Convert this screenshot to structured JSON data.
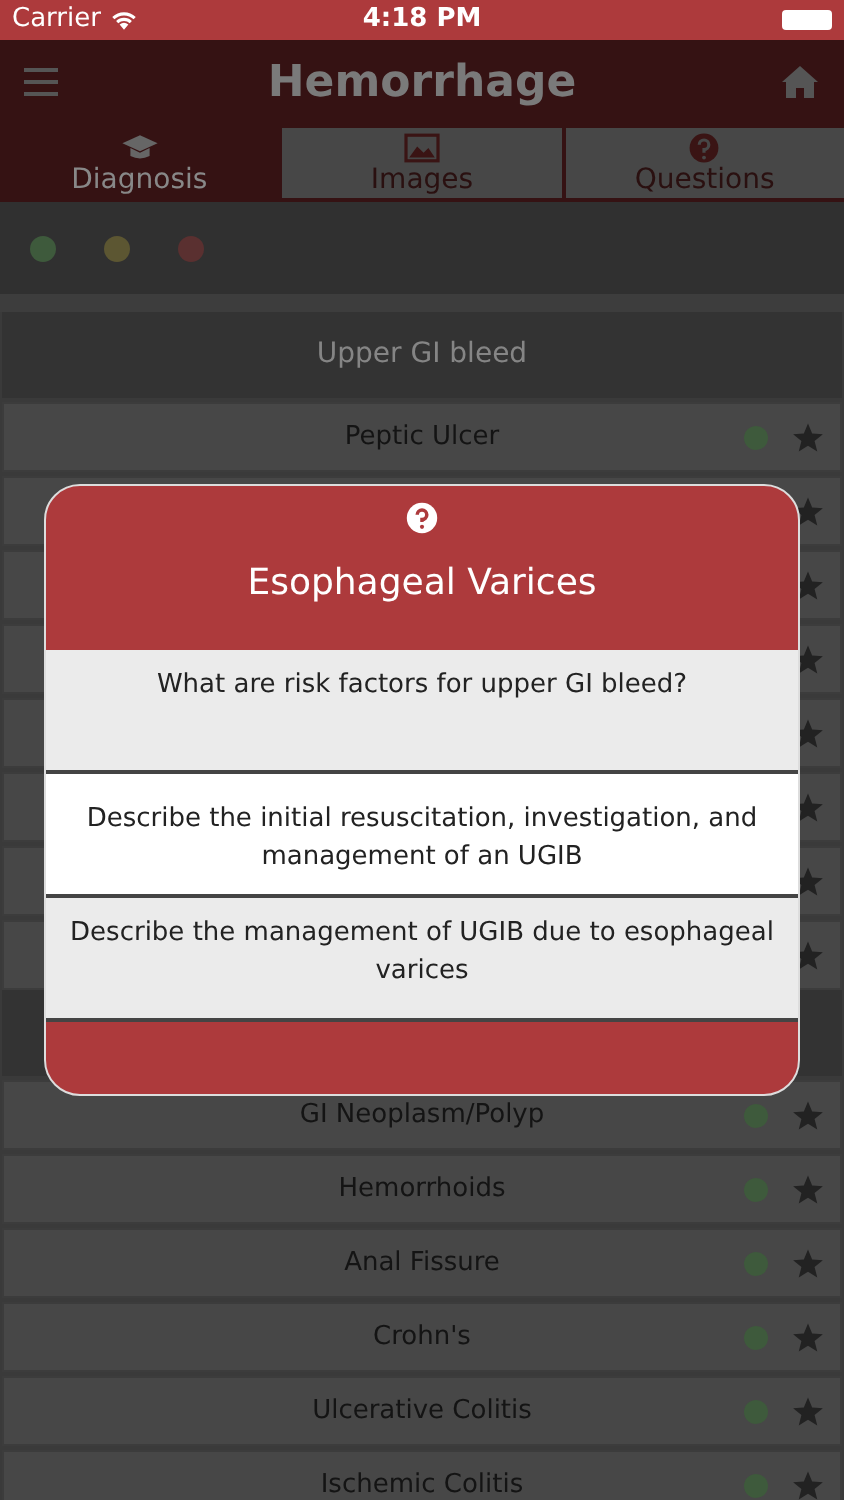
{
  "status_bar": {
    "carrier": "Carrier",
    "time": "4:18 PM"
  },
  "nav": {
    "title": "Hemorrhage"
  },
  "tabs": [
    {
      "label": "Diagnosis",
      "selected": true
    },
    {
      "label": "Images",
      "selected": false
    },
    {
      "label": "Questions",
      "selected": false
    }
  ],
  "filters": [
    {
      "color": "#3e5a3c"
    },
    {
      "color": "#5c5632"
    },
    {
      "color": "#5a3030"
    }
  ],
  "sections": [
    {
      "title": "Upper GI bleed",
      "items": [
        {
          "kind": "item",
          "label": "Peptic Ulcer",
          "color": "#3e5a3c"
        },
        {
          "kind": "covered"
        },
        {
          "kind": "covered"
        },
        {
          "kind": "covered"
        },
        {
          "kind": "covered"
        },
        {
          "kind": "covered"
        },
        {
          "kind": "covered"
        },
        {
          "kind": "covered"
        }
      ]
    },
    {
      "items": [
        {
          "kind": "item",
          "label": "GI Neoplasm/Polyp",
          "color": "#3e5a3c"
        },
        {
          "kind": "item",
          "label": "Hemorrhoids",
          "color": "#3e5a3c"
        },
        {
          "kind": "item",
          "label": "Anal Fissure",
          "color": "#3e5a3c"
        },
        {
          "kind": "item",
          "label": "Crohn's",
          "color": "#3e5a3c"
        },
        {
          "kind": "item",
          "label": "Ulcerative Colitis",
          "color": "#3e5a3c"
        },
        {
          "kind": "item",
          "label": "Ischemic Colitis",
          "color": "#3e5a3c"
        }
      ]
    }
  ],
  "dialog": {
    "title": "Esophageal Varices",
    "questions": [
      {
        "text": "What are risk factors for upper GI bleed?",
        "selected": false
      },
      {
        "text": "Describe the initial resuscitation, investigation, and management of an UGIB",
        "selected": true
      },
      {
        "text": "Describe the management of UGIB due to esophageal varices",
        "selected": false
      }
    ]
  }
}
